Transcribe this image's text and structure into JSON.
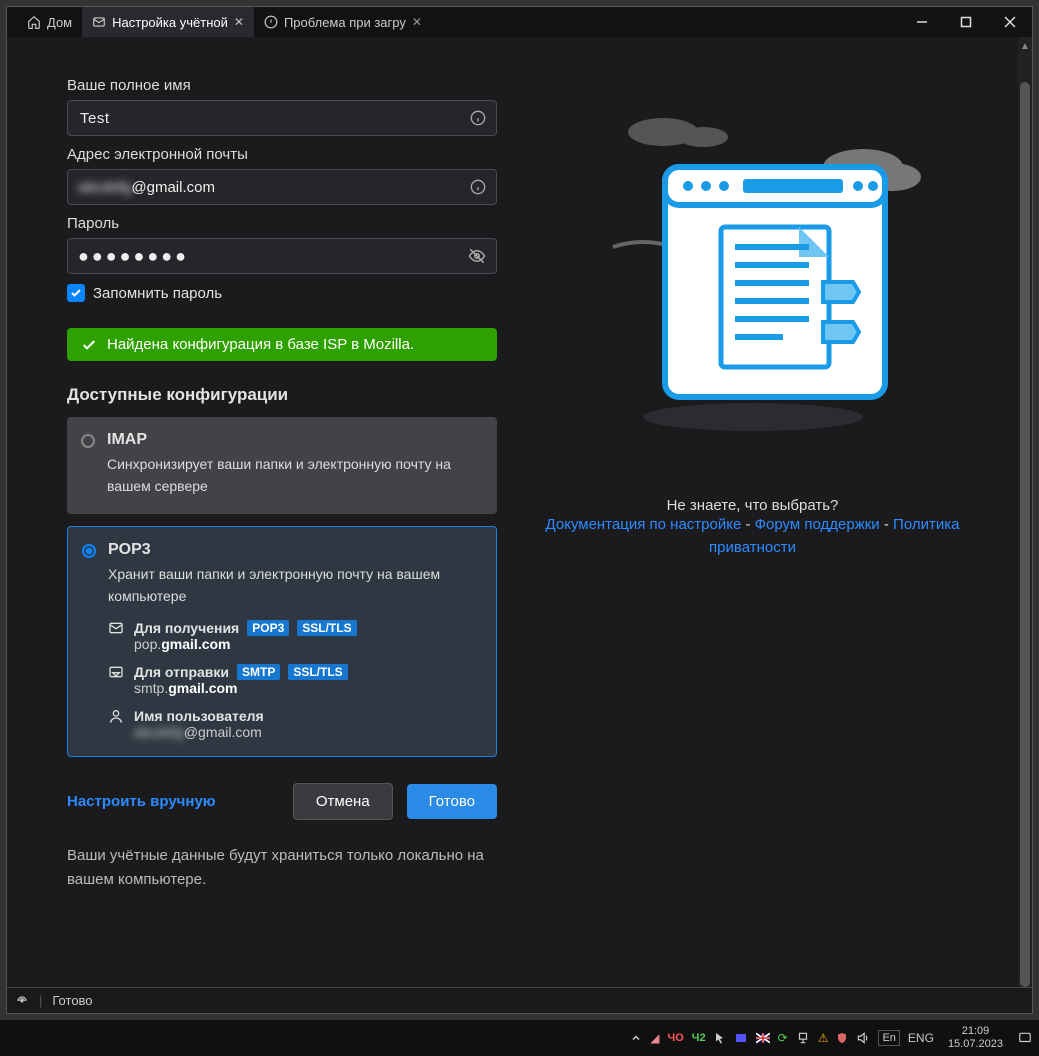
{
  "tabs": {
    "home": "Дом",
    "setup": "Настройка учётной",
    "problem": "Проблема при загру"
  },
  "form": {
    "name_label": "Ваше полное имя",
    "name_value": "Test",
    "email_label": "Адрес электронной почты",
    "email_prefix_blurred": "abcdefg",
    "email_suffix": "@gmail.com",
    "password_label": "Пароль",
    "password_masked": "●●●●●●●●",
    "remember_label": "Запомнить пароль"
  },
  "banner": {
    "success": "Найдена конфигурация в базе ISP в Mozilla."
  },
  "configs": {
    "title": "Доступные конфигурации",
    "imap": {
      "name": "IMAP",
      "desc": "Синхронизирует ваши папки и электронную почту на вашем сервере"
    },
    "pop3": {
      "name": "POP3",
      "desc": "Хранит ваши папки и электронную почту на вашем компьютере",
      "incoming_label": "Для получения",
      "incoming_proto": "POP3",
      "incoming_sec": "SSL/TLS",
      "incoming_host_prefix": "pop.",
      "incoming_host_domain": "gmail.com",
      "outgoing_label": "Для отправки",
      "outgoing_proto": "SMTP",
      "outgoing_sec": "SSL/TLS",
      "outgoing_host_prefix": "smtp.",
      "outgoing_host_domain": "gmail.com",
      "username_label": "Имя пользователя",
      "username_prefix_blurred": "abcdefg",
      "username_suffix": "@gmail.com"
    }
  },
  "actions": {
    "manual": "Настроить вручную",
    "cancel": "Отмена",
    "done": "Готово"
  },
  "footnote": "Ваши учётные данные будут храниться только локально на вашем компьютере.",
  "help": {
    "prompt": "Не знаете, что выбрать?",
    "doc": "Документация по настройке",
    "forum": "Форум поддержки",
    "privacy": "Политика приватности",
    "sep": " - "
  },
  "statusbar": {
    "ready": "Готово"
  },
  "taskbar": {
    "cpu": "ЧО",
    "gpu": "Ч2",
    "lang": "ENG",
    "time": "21:09",
    "date": "15.07.2023"
  }
}
